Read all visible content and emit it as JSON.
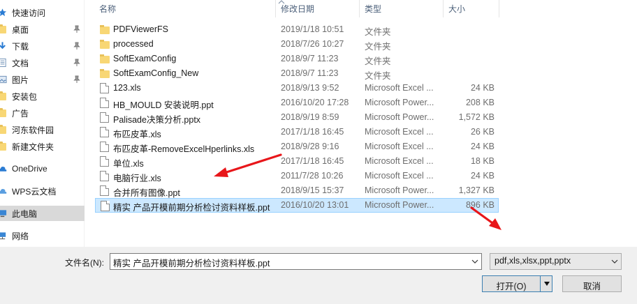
{
  "sidebar": {
    "items": [
      {
        "label": "快速访问",
        "icon": "star-icon"
      },
      {
        "label": "桌面",
        "icon": "folder-icon",
        "pinned": true
      },
      {
        "label": "下载",
        "icon": "download-icon",
        "pinned": true
      },
      {
        "label": "文档",
        "icon": "document-icon",
        "pinned": true
      },
      {
        "label": "图片",
        "icon": "picture-icon",
        "pinned": true
      },
      {
        "label": "安装包",
        "icon": "folder-icon"
      },
      {
        "label": "广告",
        "icon": "folder-icon"
      },
      {
        "label": "河东软件园",
        "icon": "folder-icon"
      },
      {
        "label": "新建文件夹",
        "icon": "folder-icon"
      },
      {
        "label": "OneDrive",
        "icon": "cloud-icon"
      },
      {
        "label": "WPS云文档",
        "icon": "cloud-icon"
      },
      {
        "label": "此电脑",
        "icon": "computer-icon",
        "selected": true
      },
      {
        "label": "网络",
        "icon": "network-icon"
      }
    ]
  },
  "columns": {
    "name": "名称",
    "date": "修改日期",
    "type": "类型",
    "size": "大小"
  },
  "files": [
    {
      "name": "PDFViewerFS",
      "date": "2019/1/18 10:51",
      "type": "文件夹",
      "size": "",
      "kind": "folder"
    },
    {
      "name": "processed",
      "date": "2018/7/26 10:27",
      "type": "文件夹",
      "size": "",
      "kind": "folder"
    },
    {
      "name": "SoftExamConfig",
      "date": "2018/9/7 11:23",
      "type": "文件夹",
      "size": "",
      "kind": "folder"
    },
    {
      "name": "SoftExamConfig_New",
      "date": "2018/9/7 11:23",
      "type": "文件夹",
      "size": "",
      "kind": "folder"
    },
    {
      "name": "123.xls",
      "date": "2018/9/13 9:52",
      "type": "Microsoft Excel ...",
      "size": "24 KB",
      "kind": "doc"
    },
    {
      "name": "HB_MOULD 安装说明.ppt",
      "date": "2016/10/20 17:28",
      "type": "Microsoft Power...",
      "size": "208 KB",
      "kind": "doc"
    },
    {
      "name": "Palisade决策分析.pptx",
      "date": "2018/9/19 8:59",
      "type": "Microsoft Power...",
      "size": "1,572 KB",
      "kind": "doc"
    },
    {
      "name": "布匹皮革.xls",
      "date": "2017/1/18 16:45",
      "type": "Microsoft Excel ...",
      "size": "26 KB",
      "kind": "doc"
    },
    {
      "name": "布匹皮革-RemoveExcelHperlinks.xls",
      "date": "2018/9/28 9:16",
      "type": "Microsoft Excel ...",
      "size": "24 KB",
      "kind": "doc"
    },
    {
      "name": "单位.xls",
      "date": "2017/1/18 16:45",
      "type": "Microsoft Excel ...",
      "size": "18 KB",
      "kind": "doc"
    },
    {
      "name": "电脑行业.xls",
      "date": "2011/7/28 10:26",
      "type": "Microsoft Excel ...",
      "size": "24 KB",
      "kind": "doc"
    },
    {
      "name": "合并所有图像.ppt",
      "date": "2018/9/15 15:37",
      "type": "Microsoft Power...",
      "size": "1,327 KB",
      "kind": "doc"
    },
    {
      "name": "精实  产品开模前期分析检讨资料样板.ppt",
      "date": "2016/10/20 13:01",
      "type": "Microsoft Power...",
      "size": "896 KB",
      "kind": "doc",
      "selected": true
    }
  ],
  "bottom": {
    "filename_label": "文件名(N):",
    "filename_value": "精实  产品开模前期分析检讨资料样板.ppt",
    "filter_value": "pdf,xls,xlsx,ppt,pptx",
    "open_label": "打开(O)",
    "cancel_label": "取消"
  },
  "colors": {
    "selection_bg": "#cce8ff",
    "selection_border": "#99d1ff",
    "annotation_arrow": "#e8161a",
    "header_text": "#4c607a"
  }
}
